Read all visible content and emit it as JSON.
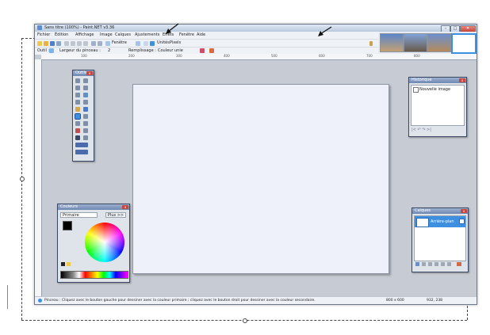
{
  "window": {
    "title": "Sans titre (100%) - Paint.NET v3.36"
  },
  "menu": [
    "Fichier",
    "Édition",
    "Affichage",
    "Image",
    "Calques",
    "Ajustements",
    "Effets",
    "Fenêtre",
    "Aide"
  ],
  "toolbar": {
    "zoom_label": "Fenêtre",
    "units_label": "Unités",
    "units_value": "Pixels"
  },
  "tooloptions": {
    "tool_label": "Outil :",
    "brush_width_label": "Largeur du pinceau :",
    "brush_width_value": "2",
    "fill_label": "Remplissage :",
    "fill_value": "Couleur unie"
  },
  "ruler": {
    "ticks": [
      "100",
      "200",
      "300",
      "400",
      "500",
      "600",
      "700",
      "800"
    ]
  },
  "panels": {
    "tools_title": "Outils",
    "history_title": "Historique",
    "history_item": "Nouvelle image",
    "colors_title": "Couleurs",
    "colors_select": "Primaire",
    "colors_more": "Plus >>",
    "layers_title": "Calques",
    "layer_name": "Arrière-plan"
  },
  "status": {
    "message": "Pinceau : Cliquez avec le bouton gauche pour dessiner avec la couleur primaire ; cliquez avec le bouton droit pour dessiner avec la couleur secondaire.",
    "size": "800 x 600",
    "coords": "932, 238"
  },
  "colors": {
    "accent": "#3d8fe0",
    "primary_swatch": "#000000",
    "secondary_swatch": "#ffffff"
  }
}
